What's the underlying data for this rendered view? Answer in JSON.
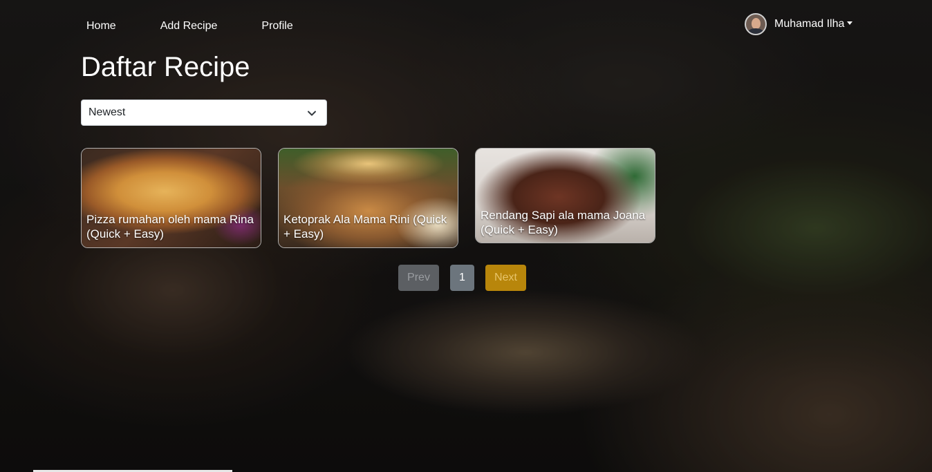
{
  "nav": {
    "home": "Home",
    "add_recipe": "Add Recipe",
    "profile": "Profile"
  },
  "user": {
    "name": "Muhamad Ilha"
  },
  "page_title": "Daftar Recipe",
  "sort": {
    "selected": "Newest"
  },
  "recipes": [
    {
      "title": "Pizza rumahan oleh mama Rina (Quick + Easy)"
    },
    {
      "title": "Ketoprak Ala Mama Rini (Quick + Easy)"
    },
    {
      "title": "Rendang Sapi ala mama Joana (Quick + Easy)"
    }
  ],
  "pagination": {
    "prev": "Prev",
    "current": "1",
    "next": "Next"
  },
  "colors": {
    "next_button": "#b8860b",
    "page_button": "#6c757d",
    "prev_button": "#5c5f63"
  }
}
